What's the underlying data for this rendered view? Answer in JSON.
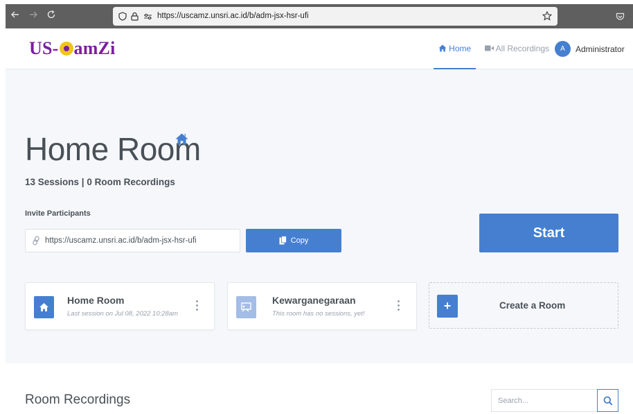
{
  "browser": {
    "url_host": "https://uscamz.unsri.ac.id",
    "url_path": "/b/adm-jsx-hsr-ufi",
    "icons": [
      "back-arrow-icon",
      "forward-arrow-icon",
      "reload-icon",
      "shield-icon",
      "lock-icon",
      "permissions-icon",
      "star-icon",
      "pocket-icon"
    ]
  },
  "header": {
    "logo_prefix": "US-",
    "logo_suffix": "amZi",
    "nav_home": "Home",
    "nav_recordings": "All Recordings",
    "avatar_initial": "A",
    "user_name": "Administrator"
  },
  "room": {
    "title": "Home Room",
    "stats": "13 Sessions | 0 Room Recordings",
    "invite_label": "Invite Participants",
    "invite_url": "https://uscamz.unsri.ac.id/b/adm-jsx-hsr-ufi",
    "copy_label": "Copy",
    "start_label": "Start"
  },
  "cards": [
    {
      "title": "Home Room",
      "subtitle": "Last session on Jul 08, 2022 10:28am",
      "icon": "home-icon",
      "color": "#467fcf"
    },
    {
      "title": "Kewarganegaraan",
      "subtitle": "This room has no sessions, yet!",
      "icon": "presentation-icon",
      "color": "#a4bde6"
    }
  ],
  "create_room_label": "Create a Room",
  "recordings": {
    "title": "Room Recordings",
    "search_placeholder": "Search..."
  },
  "colors": {
    "accent": "#467fcf",
    "logo": "#7a1fa2",
    "logo_lens": "#f0c419",
    "background": "#f5f7fb"
  }
}
